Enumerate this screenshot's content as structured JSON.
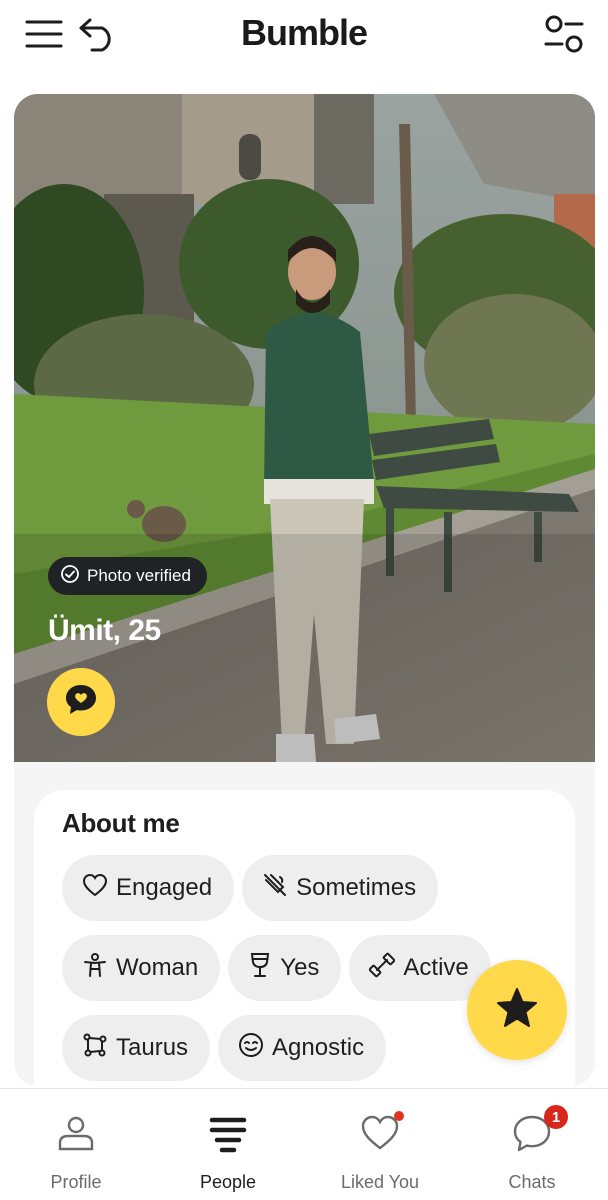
{
  "header": {
    "title": "Bumble",
    "icons": [
      "menu-icon",
      "undo-icon",
      "filter-icon"
    ]
  },
  "profile": {
    "verified_label": "Photo verified",
    "name_age": "Ümit, 25",
    "about": {
      "heading": "About me",
      "chips": [
        {
          "label": "Engaged",
          "icon": "heart-outline-icon"
        },
        {
          "label": "Sometimes",
          "icon": "no-smoking-icon"
        },
        {
          "label": "Woman",
          "icon": "person-icon"
        },
        {
          "label": "Yes",
          "icon": "wine-glass-icon"
        },
        {
          "label": "Active",
          "icon": "dumbbell-icon"
        },
        {
          "label": "Taurus",
          "icon": "constellation-icon"
        },
        {
          "label": "Agnostic",
          "icon": "smiley-icon"
        }
      ]
    }
  },
  "nav": {
    "items": [
      {
        "label": "Profile",
        "icon": "person-icon"
      },
      {
        "label": "People",
        "icon": "stack-icon"
      },
      {
        "label": "Liked You",
        "icon": "heart-icon"
      },
      {
        "label": "Chats",
        "icon": "chat-bubble-icon",
        "badge": "1"
      }
    ],
    "active": "People"
  },
  "colors": {
    "accent": "#ffd949",
    "badge": "#d7261c",
    "chip_bg": "#eeeeee"
  }
}
